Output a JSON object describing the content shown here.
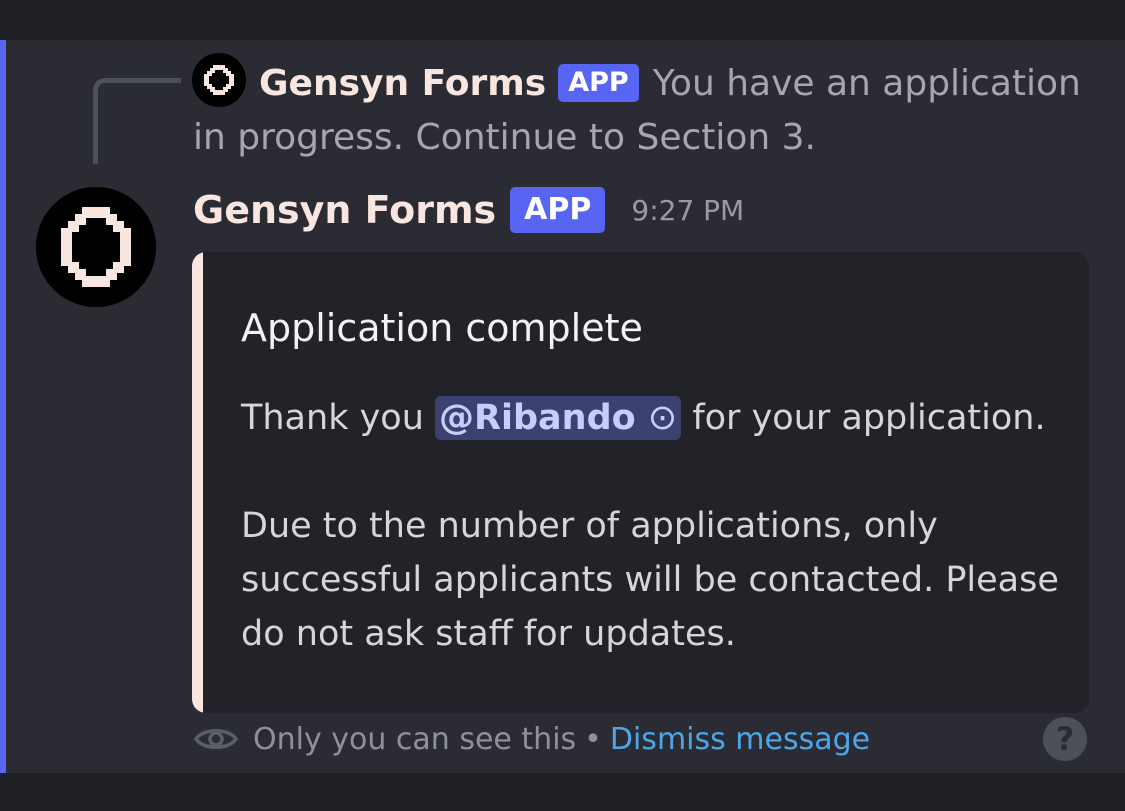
{
  "reply": {
    "username": "Gensyn Forms",
    "badge": "APP",
    "text": "You have an application in progress. Continue to Section 3.",
    "avatar_icon": "gensyn-logo-icon"
  },
  "message": {
    "username": "Gensyn Forms",
    "badge": "APP",
    "timestamp": "9:27 PM",
    "avatar_icon": "gensyn-logo-icon"
  },
  "embed": {
    "title": "Application complete",
    "line1_before": "Thank you ",
    "mention": "@Ribando",
    "mention_icon": "⊙",
    "line1_after": " for your application.",
    "paragraph2": "Due to the number of applications, only successful applicants will be contacted. Please do not ask staff for updates.",
    "border_color": "#f9e6e0"
  },
  "footer": {
    "visibility_text": "Only you can see this",
    "separator": "•",
    "dismiss_label": "Dismiss message",
    "help_label": "?"
  },
  "colors": {
    "accent": "#5865f2",
    "background": "#2b2c33",
    "link": "#4ea6e8"
  }
}
